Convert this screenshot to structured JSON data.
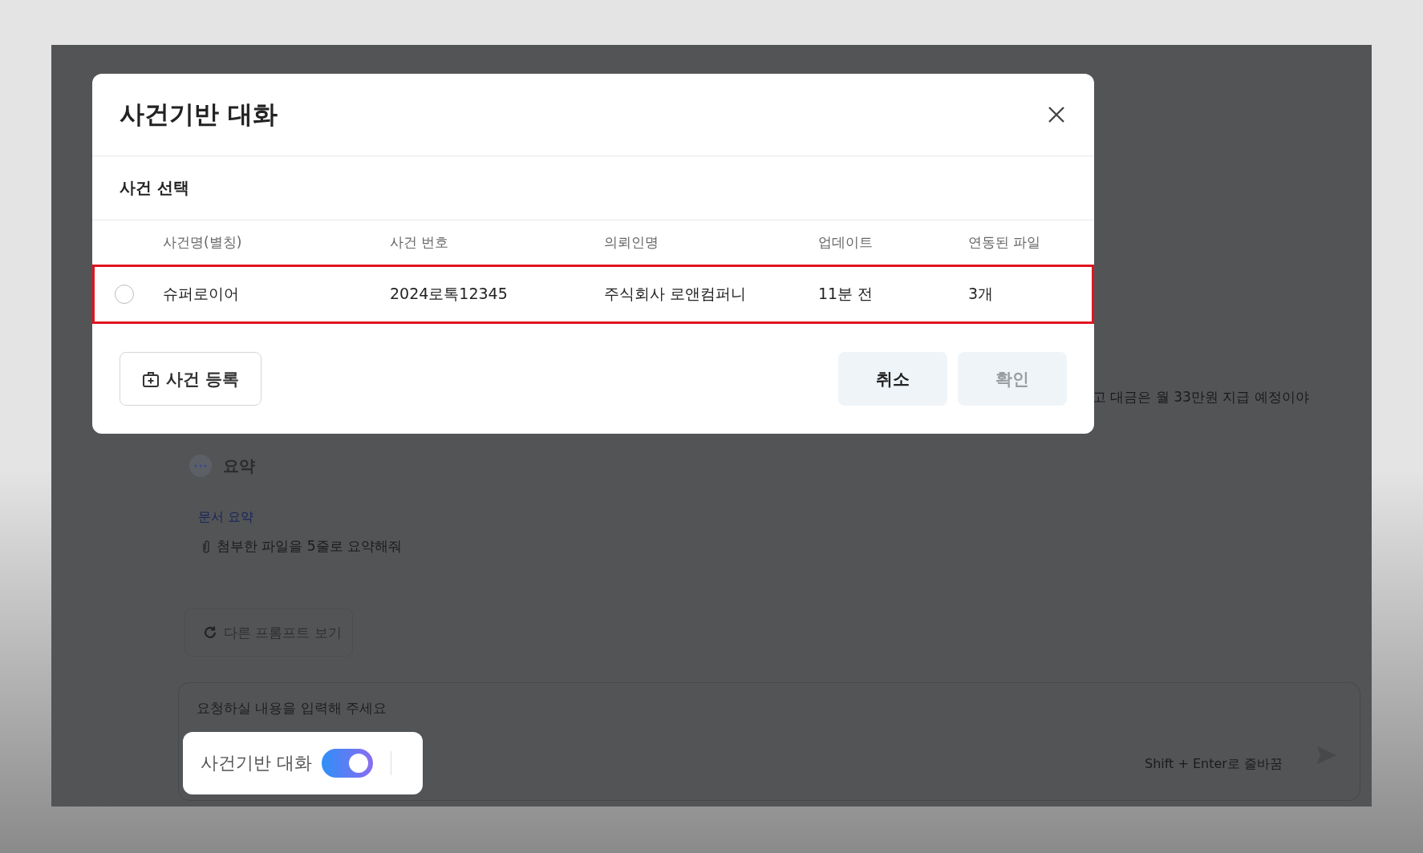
{
  "background_chat": {
    "message": "고 대금은 월 33만원 지급 예정이야",
    "summary": {
      "title": "요약",
      "link": "문서 요약",
      "attachment": "첨부한 파일을 5줄로 요약해줘"
    },
    "other_prompts_button": "다른 프롬프트 보기",
    "input": {
      "placeholder": "요청하실 내용을 입력해 주세요",
      "hint": "Shift + Enter로 줄바꿈"
    },
    "case_toggle": {
      "label": "사건기반 대화",
      "on": true
    }
  },
  "dialog": {
    "title": "사건기반 대화",
    "section": "사건 선택",
    "columns": [
      "사건명(별칭)",
      "사건 번호",
      "의뢰인명",
      "업데이트",
      "연동된 파일"
    ],
    "rows": [
      {
        "cells": [
          "슈퍼로이어",
          "2024로톡12345",
          "주식회사 로앤컴퍼니",
          "11분 전",
          "3개"
        ],
        "selected": false,
        "highlighted": true
      }
    ],
    "buttons": [
      {
        "label": "사건 등록",
        "kind": "register",
        "disabled": false
      },
      {
        "label": "취소",
        "kind": "cancel",
        "disabled": false
      },
      {
        "label": "확인",
        "kind": "confirm",
        "disabled": true
      }
    ]
  }
}
